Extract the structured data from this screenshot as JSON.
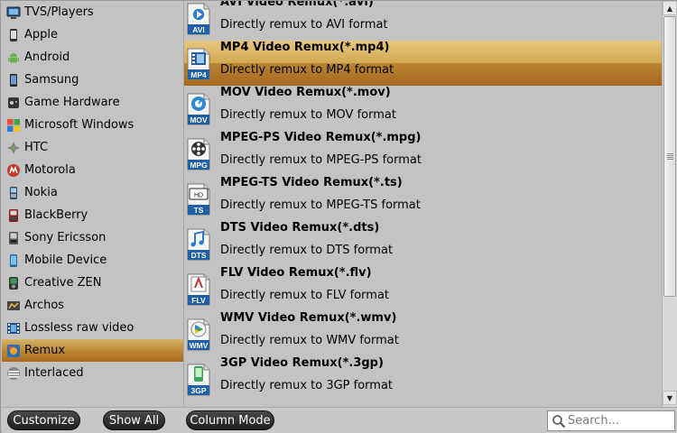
{
  "categories": [
    {
      "label": "TVS/Players",
      "icon": "tv-icon",
      "selected": false
    },
    {
      "label": "Apple",
      "icon": "apple-phone-icon",
      "selected": false
    },
    {
      "label": "Android",
      "icon": "android-icon",
      "selected": false
    },
    {
      "label": "Samsung",
      "icon": "samsung-phone-icon",
      "selected": false
    },
    {
      "label": "Game Hardware",
      "icon": "game-hardware-icon",
      "selected": false
    },
    {
      "label": "Microsoft Windows",
      "icon": "windows-icon",
      "selected": false
    },
    {
      "label": "HTC",
      "icon": "htc-icon",
      "selected": false
    },
    {
      "label": "Motorola",
      "icon": "motorola-icon",
      "selected": false
    },
    {
      "label": "Nokia",
      "icon": "nokia-phone-icon",
      "selected": false
    },
    {
      "label": "BlackBerry",
      "icon": "blackberry-icon",
      "selected": false
    },
    {
      "label": "Sony Ericsson",
      "icon": "sony-ericsson-icon",
      "selected": false
    },
    {
      "label": "Mobile Device",
      "icon": "mobile-device-icon",
      "selected": false
    },
    {
      "label": "Creative ZEN",
      "icon": "creative-zen-icon",
      "selected": false
    },
    {
      "label": "Archos",
      "icon": "archos-icon",
      "selected": false
    },
    {
      "label": "Lossless raw video",
      "icon": "film-icon",
      "selected": false
    },
    {
      "label": "Remux",
      "icon": "remux-icon",
      "selected": true
    },
    {
      "label": "Interlaced",
      "icon": "interlaced-icon",
      "selected": false
    }
  ],
  "formats": [
    {
      "title": "AVI Video Remux(*.avi)",
      "desc": "Directly remux to AVI format",
      "badge": "AVI",
      "icon": "avi-file-icon",
      "selected": false
    },
    {
      "title": "MP4 Video Remux(*.mp4)",
      "desc": "Directly remux to MP4 format",
      "badge": "MP4",
      "icon": "mp4-file-icon",
      "selected": true
    },
    {
      "title": "MOV Video Remux(*.mov)",
      "desc": "Directly remux to MOV format",
      "badge": "MOV",
      "icon": "mov-file-icon",
      "selected": false
    },
    {
      "title": "MPEG-PS Video Remux(*.mpg)",
      "desc": "Directly remux to MPEG-PS format",
      "badge": "MPG",
      "icon": "mpg-file-icon",
      "selected": false
    },
    {
      "title": "MPEG-TS Video Remux(*.ts)",
      "desc": "Directly remux to MPEG-TS format",
      "badge": "TS",
      "icon": "ts-file-icon",
      "selected": false
    },
    {
      "title": "DTS Video Remux(*.dts)",
      "desc": "Directly remux to DTS format",
      "badge": "DTS",
      "icon": "dts-file-icon",
      "selected": false
    },
    {
      "title": "FLV Video Remux(*.flv)",
      "desc": "Directly remux to FLV format",
      "badge": "FLV",
      "icon": "flv-file-icon",
      "selected": false
    },
    {
      "title": "WMV Video Remux(*.wmv)",
      "desc": "Directly remux to WMV format",
      "badge": "WMV",
      "icon": "wmv-file-icon",
      "selected": false
    },
    {
      "title": "3GP Video Remux(*.3gp)",
      "desc": "Directly remux to 3GP format",
      "badge": "3GP",
      "icon": "3gp-file-icon",
      "selected": false
    }
  ],
  "buttons": {
    "customize": "Customize",
    "show_all": "Show All",
    "column_mode": "Column Mode"
  },
  "search": {
    "placeholder": "Search...",
    "value": ""
  },
  "colors": {
    "selected_highlight": "#b8822f",
    "badge_blue": "#1e5fa8",
    "button_dark": "#2a2a2a"
  }
}
